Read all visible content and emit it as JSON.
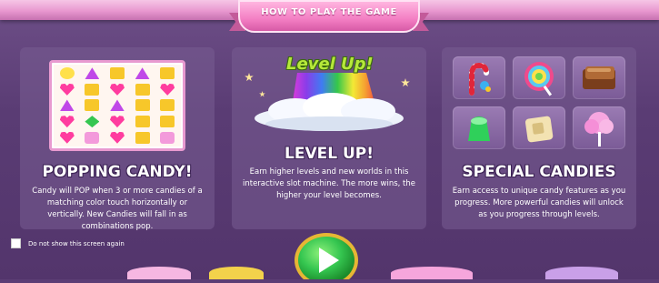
{
  "banner": {
    "title": "HOW TO PLAY THE GAME"
  },
  "panels": [
    {
      "title": "POPPING CANDY!",
      "description": "Candy will POP when 3 or more candies of a matching color touch horizontally or vertically. New Candies will fall in as combinations pop.",
      "grid": [
        [
          "bean",
          "tri",
          "sq",
          "tri",
          "sq"
        ],
        [
          "heart",
          "sq",
          "heart",
          "sq",
          "heart"
        ],
        [
          "tri",
          "sq",
          "tri",
          "sq",
          "sq"
        ],
        [
          "heart",
          "gem",
          "heart",
          "sq",
          "sq"
        ],
        [
          "heart",
          "wrap",
          "heart",
          "sq",
          "wrap"
        ]
      ]
    },
    {
      "logo": "Level Up!",
      "title": "LEVEL UP!",
      "description": "Earn higher levels and new worlds in this interactive slot machine. The more wins, the higher your level becomes."
    },
    {
      "title": "SPECIAL CANDIES",
      "description": "Earn access to unique candy features as you progress. More powerful candies will unlock as you progress through levels.",
      "candies": [
        "candy-cane-icon",
        "lollipop-icon",
        "chocolate-icon",
        "gumdrop-icon",
        "waffle-candy-icon",
        "cotton-candy-icon"
      ]
    }
  ],
  "checkbox": {
    "label": "Do not show this screen again",
    "checked": false
  },
  "play_button": {
    "icon": "play-icon"
  },
  "colors": {
    "background": "#5b3d75",
    "banner": "#f37ec3",
    "play_button": "#35c650",
    "title_text": "#ffffff"
  }
}
